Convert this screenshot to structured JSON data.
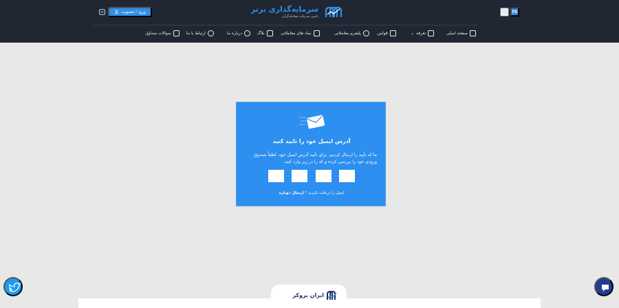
{
  "header": {
    "languages": [
      "EN",
      "FA"
    ],
    "logo_title": "سرمایه‌گذاری برتر",
    "logo_subtitle": "تامین سرمایه معامله‌گران",
    "login_label": "ورود / عضویت"
  },
  "nav": {
    "items": [
      {
        "label": "صفحه اصلی",
        "icon": "home-icon"
      },
      {
        "label": "تعرفه",
        "icon": "rocket-icon",
        "has_dropdown": true
      },
      {
        "label": "قوانین",
        "icon": "scale-icon"
      },
      {
        "label": "پلتفرم معاملاتی",
        "icon": "gauge-icon"
      },
      {
        "label": "نماد های معاملاتی",
        "icon": "cube-icon"
      },
      {
        "label": "بلاگ",
        "icon": "book-icon"
      },
      {
        "label": "درباره ما",
        "icon": "info-icon"
      },
      {
        "label": "ارتباط با ما",
        "icon": "headset-icon"
      },
      {
        "label": "سوالات متداول",
        "icon": "help-icon"
      }
    ]
  },
  "verify": {
    "title": "آدرس ایمیل خود را تایید کنید",
    "message": "ما کد تأیید را ارسال کردیم. برای تأیید آدرس ایمیل خود، لطفاً صندوق ورودی خود را بررسی کرده و کد را در زیر وارد کنید.",
    "resend_prefix": "ایمیل را دریافت نکردید ؟",
    "resend_link": "ارسال دوباره"
  },
  "footer": {
    "brand": "ایران بروکر"
  },
  "colors": {
    "header_bg": "#202632",
    "accent": "#2f8fe8",
    "card_bg": "#2d8ff0",
    "page_bg": "#e8e8e8"
  }
}
